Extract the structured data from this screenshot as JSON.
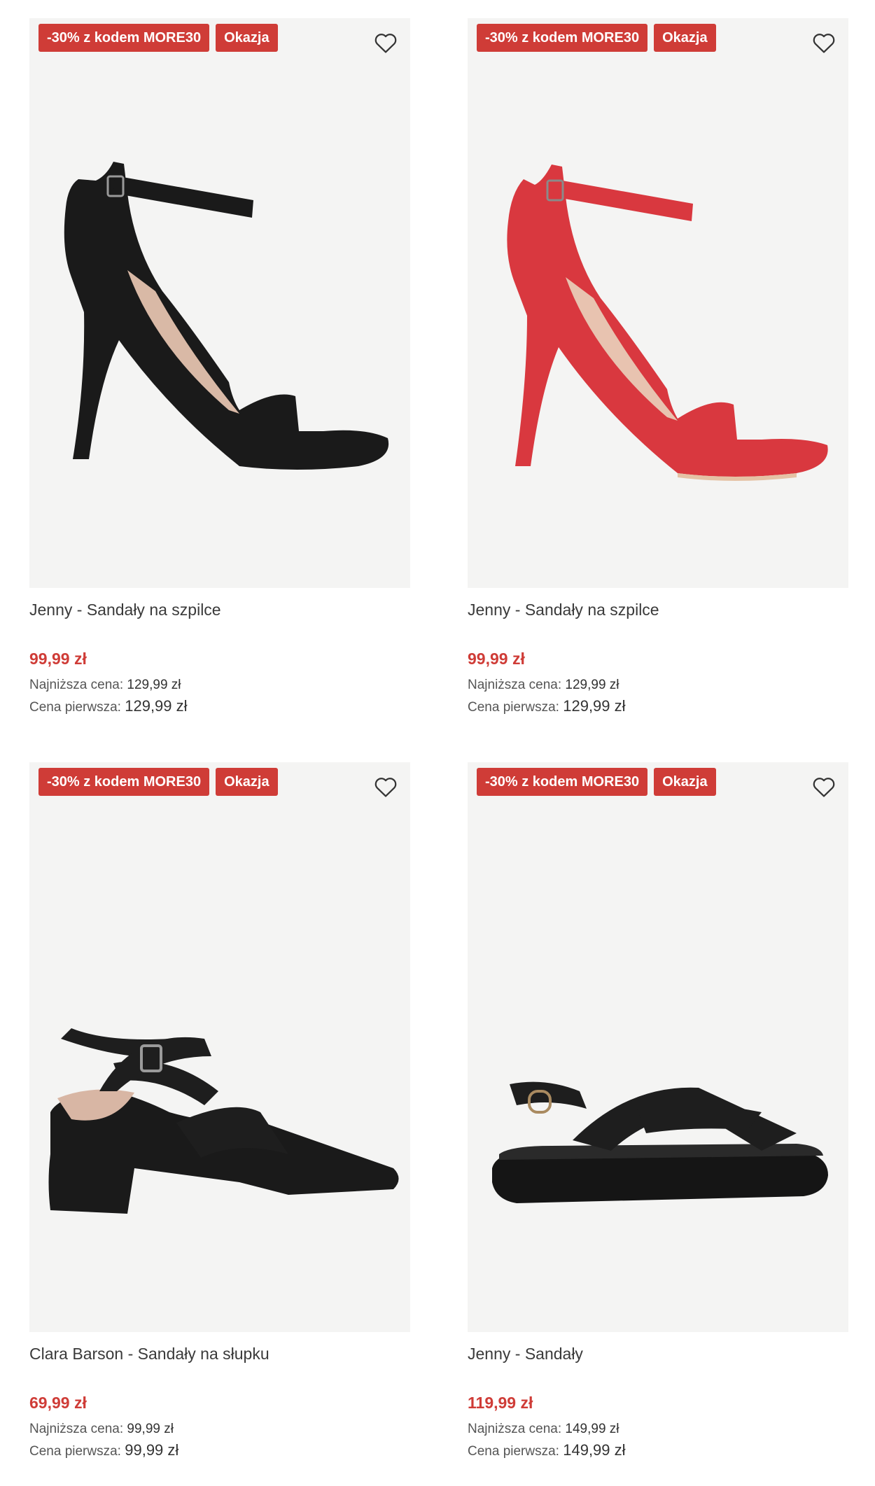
{
  "colors": {
    "badge": "#cf3c37",
    "price": "#cf3c37",
    "image_bg": "#f4f4f3"
  },
  "products": [
    {
      "badges": [
        "-30% z kodem MORE30",
        "Okazja"
      ],
      "name": "Jenny - Sandały na szpilce",
      "price": "99,99 zł",
      "lowest_label": "Najniższa cena:",
      "lowest_value": "129,99 zł",
      "first_label": "Cena pierwsza:",
      "first_value": "129,99 zł",
      "image": "black-stiletto-sandal",
      "favorite_icon": "heart-outline-icon"
    },
    {
      "badges": [
        "-30% z kodem MORE30",
        "Okazja"
      ],
      "name": "Jenny - Sandały na szpilce",
      "price": "99,99 zł",
      "lowest_label": "Najniższa cena:",
      "lowest_value": "129,99 zł",
      "first_label": "Cena pierwsza:",
      "first_value": "129,99 zł",
      "image": "red-stiletto-sandal",
      "favorite_icon": "heart-outline-icon"
    },
    {
      "badges": [
        "-30% z kodem MORE30",
        "Okazja"
      ],
      "name": "Clara Barson - Sandały na słupku",
      "price": "69,99 zł",
      "lowest_label": "Najniższa cena:",
      "lowest_value": "99,99 zł",
      "first_label": "Cena pierwsza:",
      "first_value": "99,99 zł",
      "image": "black-block-heel-sandal",
      "favorite_icon": "heart-outline-icon"
    },
    {
      "badges": [
        "-30% z kodem MORE30",
        "Okazja"
      ],
      "name": "Jenny - Sandały",
      "price": "119,99 zł",
      "lowest_label": "Najniższa cena:",
      "lowest_value": "149,99 zł",
      "first_label": "Cena pierwsza:",
      "first_value": "149,99 zł",
      "image": "black-platform-sandal",
      "favorite_icon": "heart-outline-icon"
    }
  ]
}
